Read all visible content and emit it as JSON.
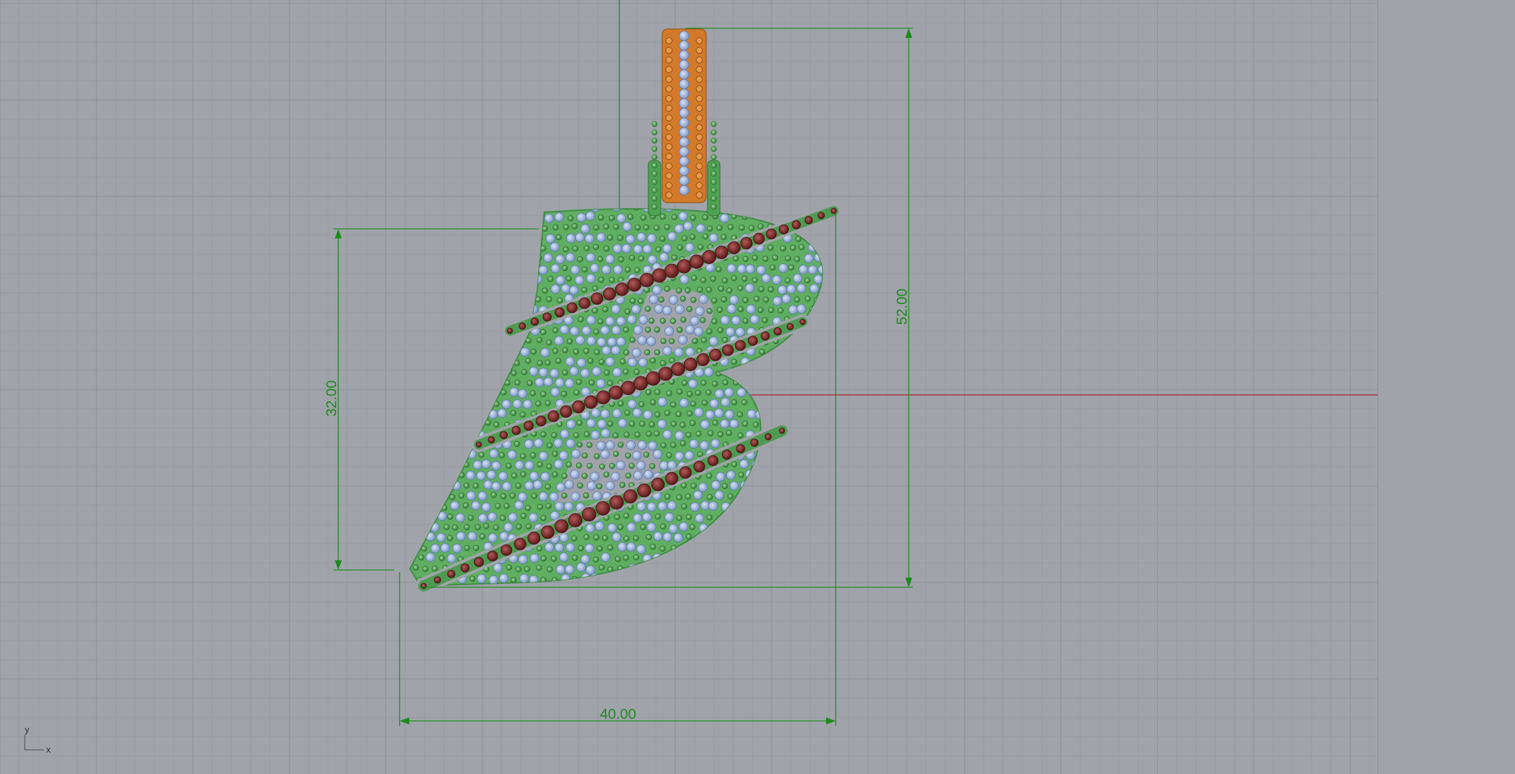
{
  "viewport": {
    "colors": {
      "background": "#a0a4aa",
      "grid_minor": "#979ba1",
      "grid_major": "#8c9096",
      "x_axis": "#b03040",
      "dimension": "#1d8a1d",
      "pendant_metal": "#5fae62",
      "stone_diamond": "#9fb4d8",
      "stone_ruby": "#7a2a2a",
      "bail_metal": "#d27a2a"
    },
    "dimensions": {
      "width": "40.00",
      "total_height": "52.00",
      "letter_height": "32.00"
    },
    "axis_labels": {
      "y": "y",
      "x": "x"
    },
    "icons": {
      "axis_widget": "axis-triad-icon"
    }
  }
}
